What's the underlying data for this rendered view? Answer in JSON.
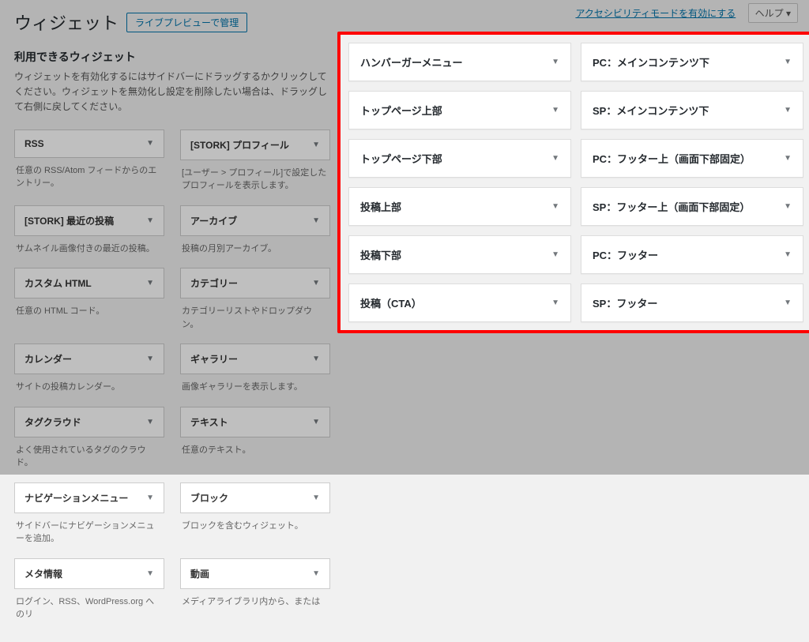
{
  "topLinks": {
    "accessibility": "アクセシビリティモードを有効にする",
    "help": "ヘルプ"
  },
  "heading": "ウィジェット",
  "livePreview": "ライブプレビューで管理",
  "availableTitle": "利用できるウィジェット",
  "availableDesc": "ウィジェットを有効化するにはサイドバーにドラッグするかクリックしてください。ウィジェットを無効化し設定を削除したい場合は、ドラッグして右側に戻してください。",
  "widgets": [
    {
      "title": "RSS",
      "desc": "任意の RSS/Atom フィードからのエントリー。"
    },
    {
      "title": "[STORK] プロフィール",
      "desc": "[ユーザー > プロフィール]で設定したプロフィールを表示します。"
    },
    {
      "title": "[STORK] 最近の投稿",
      "desc": "サムネイル画像付きの最近の投稿。"
    },
    {
      "title": "アーカイブ",
      "desc": "投稿の月別アーカイブ。"
    },
    {
      "title": "カスタム HTML",
      "desc": "任意の HTML コード。"
    },
    {
      "title": "カテゴリー",
      "desc": "カテゴリーリストやドロップダウン。"
    },
    {
      "title": "カレンダー",
      "desc": "サイトの投稿カレンダー。"
    },
    {
      "title": "ギャラリー",
      "desc": "画像ギャラリーを表示します。"
    },
    {
      "title": "タグクラウド",
      "desc": "よく使用されているタグのクラウド。"
    },
    {
      "title": "テキスト",
      "desc": "任意のテキスト。"
    },
    {
      "title": "ナビゲーションメニュー",
      "desc": "サイドバーにナビゲーションメニューを追加。"
    },
    {
      "title": "ブロック",
      "desc": "ブロックを含むウィジェット。"
    },
    {
      "title": "メタ情報",
      "desc": "ログイン、RSS、WordPress.org へのリ"
    },
    {
      "title": "動画",
      "desc": "メディアライブラリ内から、または"
    }
  ],
  "areas": {
    "left": [
      "ハンバーガーメニュー",
      "トップページ上部",
      "トップページ下部",
      "投稿上部",
      "投稿下部",
      "投稿（CTA）"
    ],
    "right": [
      "PC：メインコンテンツ下",
      "SP：メインコンテンツ下",
      "PC：フッター上（画面下部固定）",
      "SP：フッター上（画面下部固定）",
      "PC：フッター",
      "SP：フッター"
    ]
  }
}
